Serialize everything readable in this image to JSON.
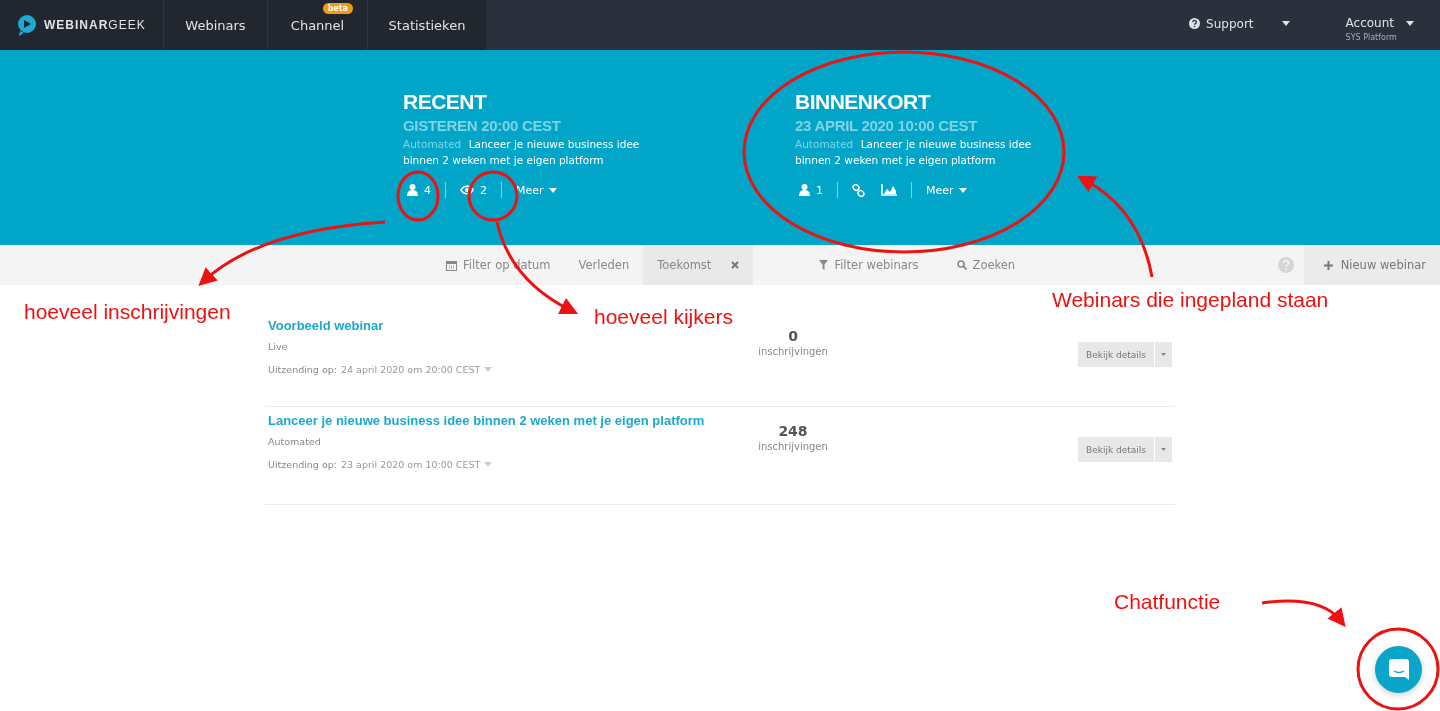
{
  "navbar": {
    "logo": "**WEBINAR**GEEK",
    "tabs": [
      {
        "label": "Webinars"
      },
      {
        "label": "Channel",
        "badge": "beta"
      },
      {
        "label": "Statistieken"
      }
    ],
    "support": "Support",
    "account": "Account",
    "account_sub": "SYS Platform"
  },
  "hero": [
    {
      "heading": "RECENT",
      "datetime": "GISTEREN 20:00 CEST",
      "type": "Automated",
      "title": "Lanceer je nieuwe business idee binnen 2 weken met je eigen platform",
      "stats": [
        {
          "kind": "registrations",
          "value": "4"
        },
        {
          "kind": "viewers",
          "value": "2"
        }
      ],
      "more": "Meer"
    },
    {
      "heading": "BINNENKORT",
      "datetime": "23 APRIL 2020 10:00 CEST",
      "type": "Automated",
      "title": "Lanceer je nieuwe business idee binnen 2 weken met je eigen platform",
      "stats": [
        {
          "kind": "registrations",
          "value": "1"
        },
        {
          "kind": "links"
        }
      ],
      "more": "Meer"
    }
  ],
  "filter_bar": {
    "date_filter": "Filter op datum",
    "tabs": [
      {
        "label": "Verleden",
        "selected": false
      },
      {
        "label": "Toekomst",
        "selected": true
      }
    ],
    "webinar_filter": "Filter webinars",
    "search": "Zoeken",
    "new_button": "Nieuw webinar"
  },
  "webinars": [
    {
      "title": "Voorbeeld webinar",
      "type": "Live",
      "broadcast_label": "Uitzending op:",
      "date": "24 april 2020 om 20:00 CEST",
      "count": "0",
      "count_label": "inschrijvingen",
      "button": "Bekijk details"
    },
    {
      "title": "Lanceer je nieuwe business idee binnen 2 weken met je eigen platform",
      "type": "Automated",
      "broadcast_label": "Uitzending op:",
      "date": "23 april 2020 om 10:00 CEST",
      "count": "248",
      "count_label": "inschrijvingen",
      "button": "Bekijk details"
    }
  ],
  "annotations": [
    "hoeveel inschrijvingen",
    "hoeveel kijkers",
    "Webinars die ingepland staan",
    "Chatfunctie"
  ]
}
